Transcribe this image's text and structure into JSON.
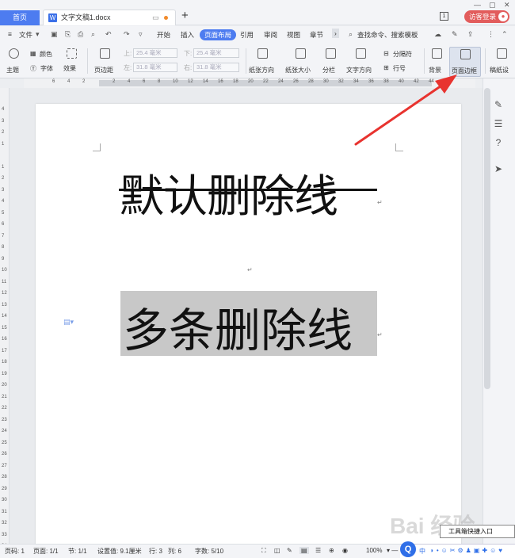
{
  "titlebar": {
    "home_tab": "首页",
    "doc_tab": "文字文稿1.docx",
    "new_tab": "+",
    "badge": "1",
    "login": "访客登录"
  },
  "menu": {
    "file": "文件",
    "items": [
      "开始",
      "插入",
      "页面布局",
      "引用",
      "审阅",
      "视图",
      "章节"
    ],
    "active": "页面布局",
    "search": "查找命令、搜索模板"
  },
  "ribbon": {
    "theme": "主题",
    "color": "颜色",
    "font": "字体",
    "effect": "效果",
    "margin": "页边距",
    "top_label": "上:",
    "top_value": "25.4 毫米",
    "bottom_label": "下:",
    "bottom_value": "25.4 毫米",
    "left_label": "左:",
    "left_value": "31.8 毫米",
    "right_label": "右:",
    "right_value": "31.8 毫米",
    "orientation": "纸张方向",
    "size": "纸张大小",
    "columns": "分栏",
    "text_direction": "文字方向",
    "breaks": "分隔符",
    "line_numbers": "行号",
    "background": "背景",
    "page_border": "页面边框",
    "manuscript": "稿纸设"
  },
  "ruler": {
    "h_ticks": [
      "6",
      "4",
      "2",
      "",
      "2",
      "4",
      "6",
      "8",
      "10",
      "12",
      "14",
      "16",
      "18",
      "20",
      "22",
      "24",
      "26",
      "28",
      "30",
      "32",
      "34",
      "36",
      "38",
      "40",
      "42",
      "44",
      "46"
    ],
    "v_ticks": [
      "4",
      "3",
      "2",
      "1",
      "",
      "1",
      "2",
      "3",
      "4",
      "5",
      "6",
      "7",
      "8",
      "9",
      "10",
      "11",
      "12",
      "13",
      "14",
      "15",
      "16",
      "17",
      "18",
      "19",
      "20",
      "21",
      "22",
      "23",
      "24",
      "25",
      "26",
      "27",
      "28",
      "29",
      "30",
      "31",
      "32",
      "33",
      "34"
    ]
  },
  "document": {
    "line1": "默认删除线",
    "line2": "多条删除线",
    "para_mark": "↵"
  },
  "status": {
    "page_num": "页码: 1",
    "page": "页面: 1/1",
    "section": "节: 1/1",
    "setting": "设置值: 9.1厘米",
    "row": "行: 3",
    "col": "列: 6",
    "words": "字数: 5/10",
    "zoom": "100%",
    "tooltip": "工具箱快捷入口",
    "ime_lang": "中"
  },
  "watermark": "Bai 经验",
  "colors": {
    "accent": "#4d7cf0",
    "login": "#e25c5c",
    "arrow": "#e8332f",
    "highlight": "#c8c8c8"
  }
}
